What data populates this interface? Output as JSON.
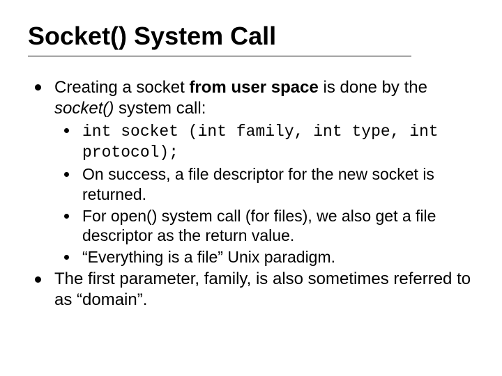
{
  "title": "Socket() System Call",
  "bullets": {
    "b1_pre": "Creating a socket ",
    "b1_bold": "from user space",
    "b1_mid": " is done by the ",
    "b1_italic": "socket()",
    "b1_post": " system call:",
    "sub1": "int socket (int family, int type, int protocol);",
    "sub2": "On success, a file descriptor for the new socket is returned.",
    "sub3": "For open() system call (for files), we also get a file descriptor as the return value.",
    "sub4": "“Everything is a file” Unix paradigm.",
    "b2": "The first parameter, family, is also sometimes referred to as “domain”."
  }
}
